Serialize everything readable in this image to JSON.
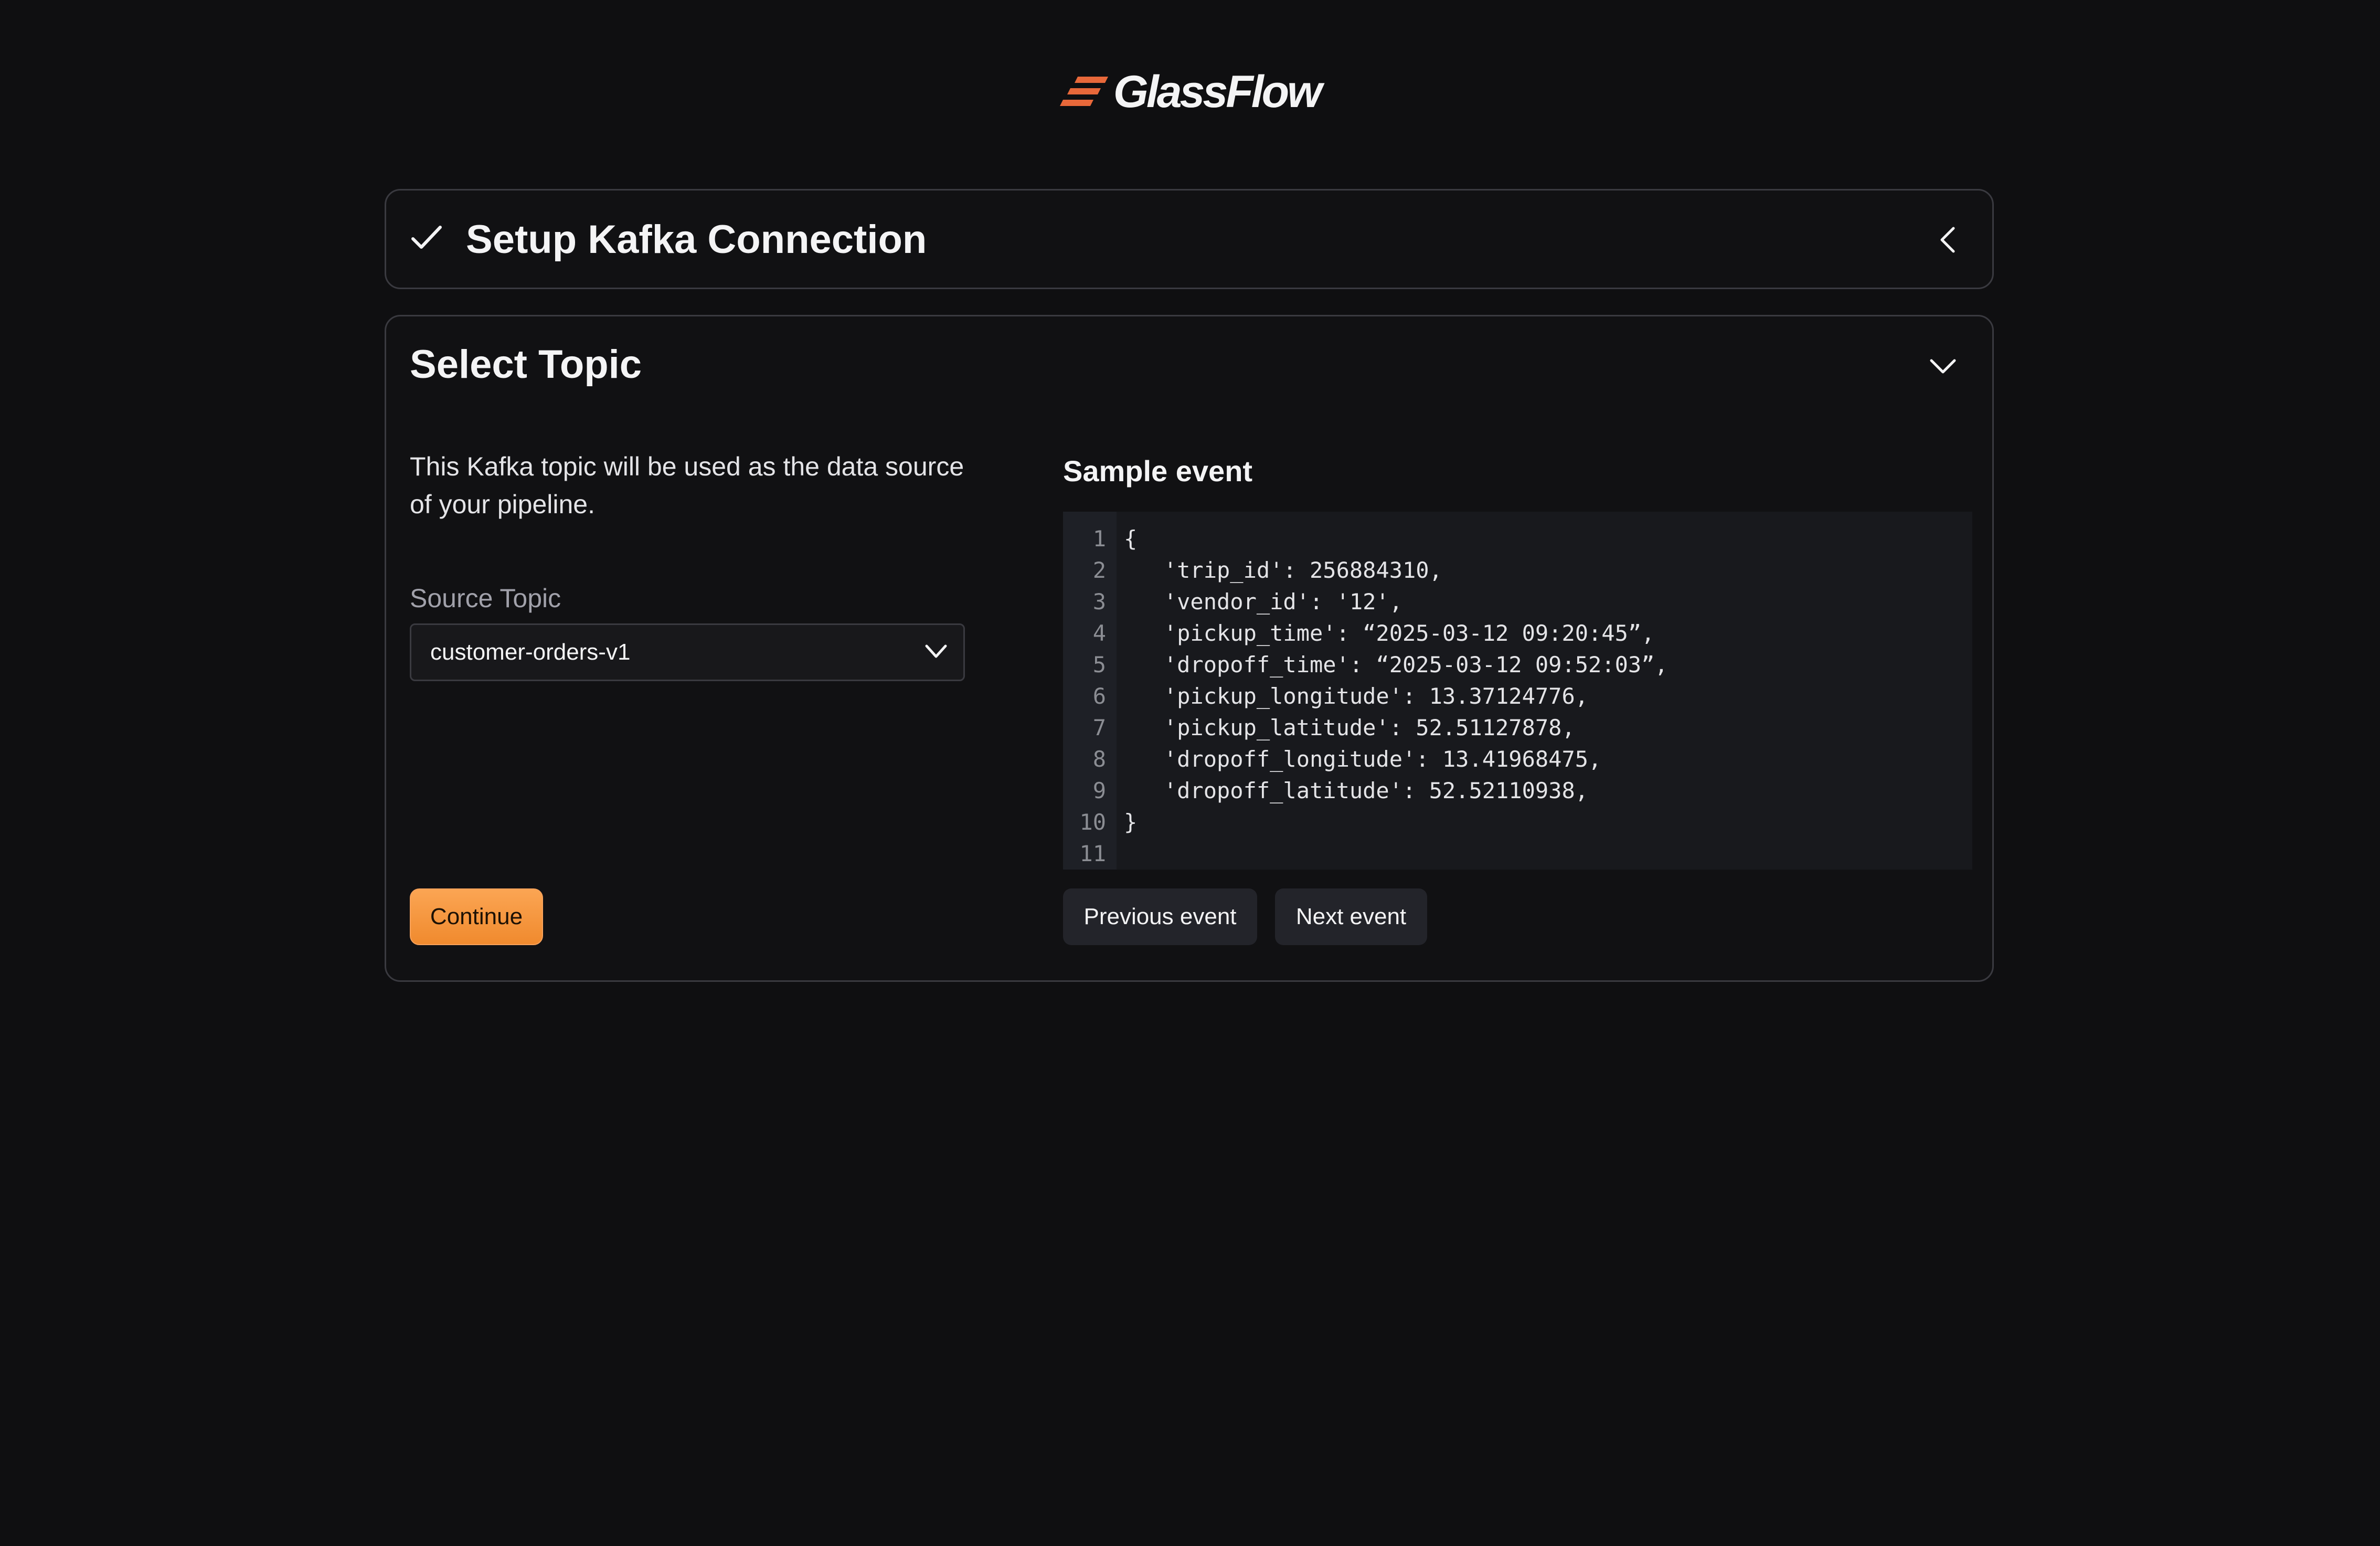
{
  "brand": {
    "name": "GlassFlow",
    "logo_color": "#e8683a"
  },
  "steps": {
    "setup_kafka": {
      "title": "Setup Kafka Connection",
      "status_icon": "check-icon",
      "toggle_icon": "chevron-left-icon",
      "state": "collapsed"
    },
    "select_topic": {
      "title": "Select Topic",
      "toggle_icon": "chevron-down-icon",
      "state": "expanded",
      "description": "This Kafka topic will be used as the data source of your pipeline.",
      "source_topic": {
        "label": "Source Topic",
        "value": "customer-orders-v1"
      },
      "continue_label": "Continue",
      "sample_event": {
        "title": "Sample event",
        "line_numbers": [
          "1",
          "2",
          "3",
          "4",
          "5",
          "6",
          "7",
          "8",
          "9",
          "10",
          "11"
        ],
        "lines": [
          "{",
          "   'trip_id': 256884310,",
          "   'vendor_id': '12',",
          "   'pickup_time': “2025-03-12 09:20:45”,",
          "   'dropoff_time': “2025-03-12 09:52:03”,",
          "   'pickup_longitude': 13.37124776,",
          "   'pickup_latitude': 52.51127878,",
          "   'dropoff_longitude': 13.41968475,",
          "   'dropoff_latitude': 52.52110938,",
          "}",
          ""
        ],
        "previous_label": "Previous event",
        "next_label": "Next event"
      }
    }
  },
  "colors": {
    "background": "#0f0f11",
    "accent": "#f59a3f",
    "card_border": "#3a3a40"
  }
}
